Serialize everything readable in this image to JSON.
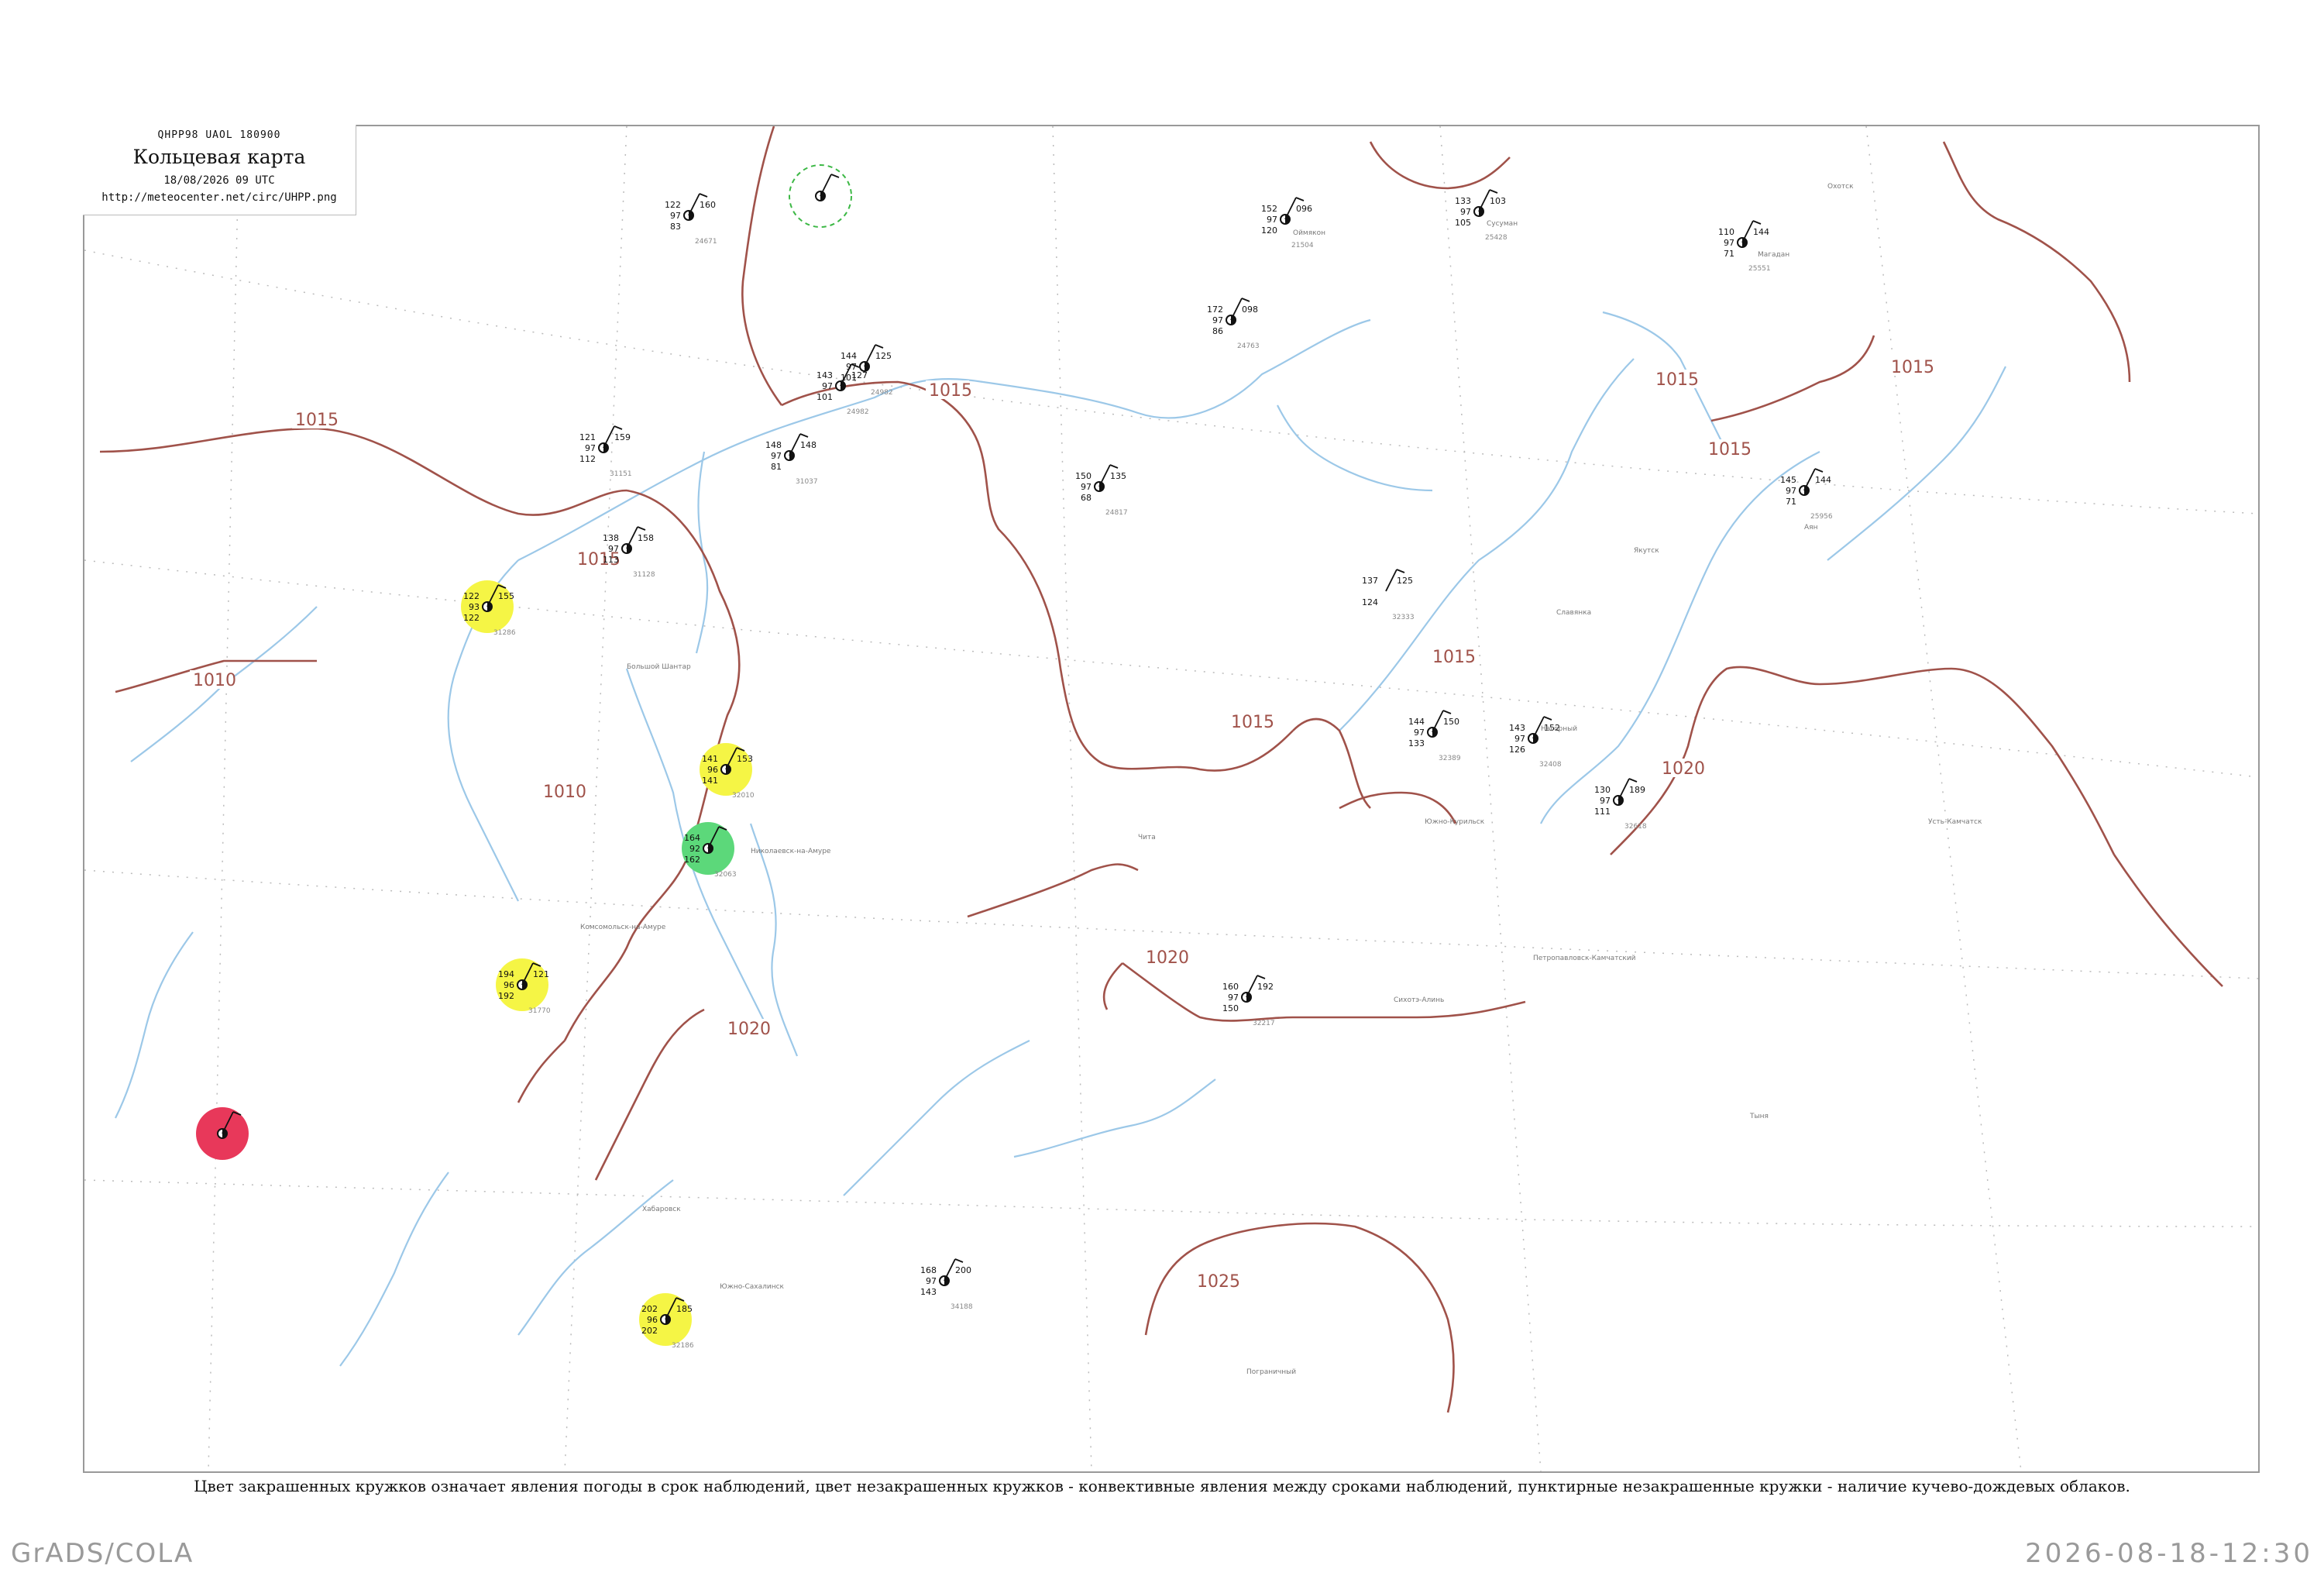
{
  "header": {
    "code_line": "QHPP98  UAOL  180900",
    "title": "Кольцевая карта",
    "datetime": "18/08/2026 09 UTC",
    "url": "http://meteocenter.net/circ/UHPP.png"
  },
  "footnote": "Цвет закрашенных кружков означает явления погоды в срок наблюдений, цвет незакрашенных кружков - конвективные явления между сроками наблюдений, пунктирные незакрашенные кружки - наличие кучево-дождевых облаков.",
  "footer": {
    "left": "GrADS/COLA",
    "right": "2026-08-18-12:30"
  },
  "colors": {
    "isobar": "#a0524a",
    "coast_river": "#9cc8e8",
    "grid": "#bbbbbb",
    "rain": "#1cb832",
    "shower_dashed": "#3cb845",
    "fog_yellow": "#f5f545",
    "drizzle_light": "#5cd87a",
    "thunder_red": "#e8385a"
  },
  "isobars": [
    {
      "label": "1015"
    },
    {
      "label": "1015"
    },
    {
      "label": "1015"
    },
    {
      "label": "1015"
    },
    {
      "label": "1015"
    },
    {
      "label": "1015"
    },
    {
      "label": "1015"
    },
    {
      "label": "1015"
    },
    {
      "label": "1010"
    },
    {
      "label": "1010"
    },
    {
      "label": "1020"
    },
    {
      "label": "1020"
    },
    {
      "label": "1020"
    },
    {
      "label": "1025"
    }
  ],
  "stations": [
    {
      "pressure": "152",
      "temp": "97",
      "dew": "120",
      "right": "096",
      "id": "21504",
      "symbol": "rain",
      "marker": "none"
    },
    {
      "pressure": "110",
      "temp": "97",
      "dew": "71",
      "right": "144",
      "id": "25551",
      "symbol": "cloud",
      "marker": "none"
    },
    {
      "pressure": "133",
      "temp": "97",
      "dew": "105",
      "right": "103",
      "id": "25428",
      "symbol": "cloud",
      "marker": "none"
    },
    {
      "pressure": "172",
      "temp": "97",
      "dew": "86",
      "right": "098",
      "id": "24763",
      "symbol": "cloud",
      "marker": "none"
    },
    {
      "pressure": "150",
      "temp": "97",
      "dew": "68",
      "right": "135",
      "id": "24817",
      "symbol": "cloud",
      "marker": "none"
    },
    {
      "pressure": "145",
      "temp": "97",
      "dew": "71",
      "right": "144",
      "id": "25956",
      "symbol": "cloud",
      "marker": "none"
    },
    {
      "pressure": "137",
      "temp": "",
      "dew": "124",
      "right": "125",
      "id": "32333",
      "symbol": "none",
      "marker": "none"
    },
    {
      "pressure": "144",
      "temp": "97",
      "dew": "133",
      "right": "150",
      "id": "32389",
      "symbol": "cloud",
      "marker": "none"
    },
    {
      "pressure": "143",
      "temp": "97",
      "dew": "126",
      "right": "152",
      "id": "32408",
      "symbol": "cloud",
      "marker": "none"
    },
    {
      "pressure": "130",
      "temp": "97",
      "dew": "111",
      "right": "189",
      "id": "32618",
      "symbol": "cloud",
      "marker": "none"
    },
    {
      "pressure": "160",
      "temp": "97",
      "dew": "150",
      "right": "192",
      "id": "32217",
      "symbol": "cloud",
      "marker": "none"
    },
    {
      "pressure": "168",
      "temp": "97",
      "dew": "143",
      "right": "200",
      "id": "34188",
      "symbol": "cloud",
      "marker": "none"
    },
    {
      "pressure": "141",
      "temp": "96",
      "dew": "141",
      "right": "153",
      "id": "32010",
      "symbol": "fog",
      "marker": "yellow"
    },
    {
      "pressure": "122",
      "temp": "93",
      "dew": "122",
      "right": "155",
      "id": "31286",
      "symbol": "fog",
      "marker": "yellow"
    },
    {
      "pressure": "194",
      "temp": "96",
      "dew": "192",
      "right": "121",
      "id": "31770",
      "symbol": "fog",
      "marker": "yellow"
    },
    {
      "pressure": "202",
      "temp": "96",
      "dew": "202",
      "right": "185",
      "id": "32186",
      "symbol": "fog",
      "marker": "yellow"
    },
    {
      "pressure": "164",
      "temp": "92",
      "dew": "162",
      "right": "",
      "id": "32063",
      "symbol": "drizzle",
      "marker": "lightgreen"
    },
    {
      "pressure": "",
      "temp": "",
      "dew": "",
      "right": "",
      "id": "",
      "symbol": "thunder",
      "marker": "red"
    },
    {
      "pressure": "121",
      "temp": "97",
      "dew": "112",
      "right": "159",
      "id": "31151",
      "symbol": "cloud",
      "marker": "none"
    },
    {
      "pressure": "138",
      "temp": "97",
      "dew": "113",
      "right": "158",
      "id": "31128",
      "symbol": "cloud",
      "marker": "none"
    },
    {
      "pressure": "144",
      "temp": "97",
      "dew": "101",
      "right": "125",
      "id": "24982",
      "symbol": "cloud",
      "marker": "none"
    },
    {
      "pressure": "143",
      "temp": "97",
      "dew": "101",
      "right": "127",
      "id": "24982",
      "symbol": "cloud",
      "marker": "none"
    },
    {
      "pressure": "148",
      "temp": "97",
      "dew": "81",
      "right": "148",
      "id": "31037",
      "symbol": "cloud",
      "marker": "none"
    },
    {
      "pressure": "122",
      "temp": "97",
      "dew": "83",
      "right": "160",
      "id": "24671",
      "symbol": "cloud",
      "marker": "none"
    },
    {
      "pressure": "",
      "temp": "",
      "dew": "",
      "right": "",
      "id": "",
      "symbol": "cloud",
      "marker": "dashed"
    }
  ],
  "place_names": [
    "Оймякон",
    "Сусуман",
    "Магадан",
    "Охотск",
    "Аян",
    "Большой Шантар",
    "Николаевск-на-Амуре",
    "Комсомольск-на-Амуре",
    "Хабаровск",
    "Южно-Сахалинск",
    "Петропавловск-Камчатский",
    "Усть-Камчатск",
    "Южно-Курильск",
    "Славянка",
    "Нагорный",
    "Якутск",
    "Чита",
    "Тыня",
    "Пограничный",
    "Сихотэ-Алинь"
  ]
}
